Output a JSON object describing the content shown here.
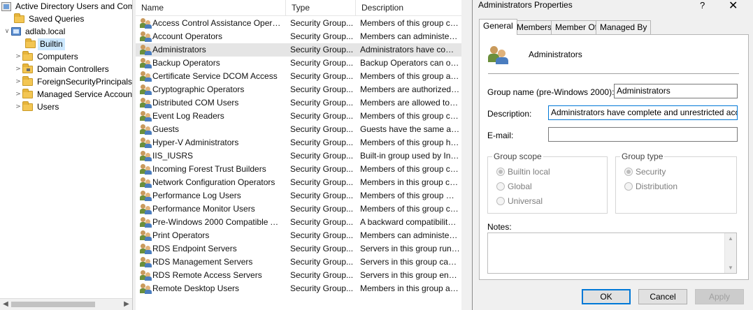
{
  "tree": {
    "root": "Active Directory Users and Computers",
    "items": [
      {
        "label": "Saved Queries",
        "icon": "folder-icon",
        "expander": ""
      },
      {
        "label": "adlab.local",
        "icon": "domain-icon",
        "expander": "∨"
      },
      {
        "label": "Builtin",
        "icon": "folder-icon",
        "expander": "",
        "selected": true
      },
      {
        "label": "Computers",
        "icon": "folder-icon",
        "expander": ">"
      },
      {
        "label": "Domain Controllers",
        "icon": "ou-folder-icon",
        "expander": ">"
      },
      {
        "label": "ForeignSecurityPrincipals",
        "icon": "folder-icon",
        "expander": ">"
      },
      {
        "label": "Managed Service Accounts",
        "icon": "folder-icon",
        "expander": ">"
      },
      {
        "label": "Users",
        "icon": "folder-icon",
        "expander": ">"
      }
    ]
  },
  "list": {
    "columns": {
      "name": "Name",
      "type": "Type",
      "description": "Description"
    },
    "rows": [
      {
        "name": "Access Control Assistance Operators",
        "type": "Security Group...",
        "description": "Members of this group can remotely query authorization attributes"
      },
      {
        "name": "Account Operators",
        "type": "Security Group...",
        "description": "Members can administer domain user and group accounts"
      },
      {
        "name": "Administrators",
        "type": "Security Group...",
        "description": "Administrators have complete and unrestricted access",
        "selected": true
      },
      {
        "name": "Backup Operators",
        "type": "Security Group...",
        "description": "Backup Operators can override security restrictions"
      },
      {
        "name": "Certificate Service DCOM Access",
        "type": "Security Group...",
        "description": "Members of this group are allowed to connect"
      },
      {
        "name": "Cryptographic Operators",
        "type": "Security Group...",
        "description": "Members are authorized to perform cryptographic operations"
      },
      {
        "name": "Distributed COM Users",
        "type": "Security Group...",
        "description": "Members are allowed to launch, activate and use"
      },
      {
        "name": "Event Log Readers",
        "type": "Security Group...",
        "description": "Members of this group can read event logs"
      },
      {
        "name": "Guests",
        "type": "Security Group...",
        "description": "Guests have the same access as members of the Users group"
      },
      {
        "name": "Hyper-V Administrators",
        "type": "Security Group...",
        "description": "Members of this group have complete access"
      },
      {
        "name": "IIS_IUSRS",
        "type": "Security Group...",
        "description": "Built-in group used by Internet Information Services"
      },
      {
        "name": "Incoming Forest Trust Builders",
        "type": "Security Group...",
        "description": "Members of this group can create incoming"
      },
      {
        "name": "Network Configuration Operators",
        "type": "Security Group...",
        "description": "Members in this group can have some privileges"
      },
      {
        "name": "Performance Log Users",
        "type": "Security Group...",
        "description": "Members of this group may schedule logging"
      },
      {
        "name": "Performance Monitor Users",
        "type": "Security Group...",
        "description": "Members of this group can access performance counter data"
      },
      {
        "name": "Pre-Windows 2000 Compatible Access",
        "type": "Security Group...",
        "description": "A backward compatibility group which allows read access"
      },
      {
        "name": "Print Operators",
        "type": "Security Group...",
        "description": "Members can administer printers installed on domain controllers"
      },
      {
        "name": "RDS Endpoint Servers",
        "type": "Security Group...",
        "description": "Servers in this group run virtual machines"
      },
      {
        "name": "RDS Management Servers",
        "type": "Security Group...",
        "description": "Servers in this group can perform routine administrative actions"
      },
      {
        "name": "RDS Remote Access Servers",
        "type": "Security Group...",
        "description": "Servers in this group enable users of RemoteApp programs"
      },
      {
        "name": "Remote Desktop Users",
        "type": "Security Group...",
        "description": "Members in this group are granted the right to logon remotely"
      }
    ]
  },
  "dialog": {
    "title": "Administrators Properties",
    "help": "?",
    "close": "✕",
    "tabs": [
      "General",
      "Members",
      "Member Of",
      "Managed By"
    ],
    "group_display_name": "Administrators",
    "fields": {
      "group_name_label": "Group name (pre-Windows 2000):",
      "group_name_value": "Administrators",
      "description_label": "Description:",
      "description_value": "Administrators have complete and unrestricted access to the computer/domain",
      "email_label": "E-mail:",
      "email_value": ""
    },
    "group_scope": {
      "title": "Group scope",
      "options": [
        "Builtin local",
        "Global",
        "Universal"
      ],
      "selected": 0
    },
    "group_type": {
      "title": "Group type",
      "options": [
        "Security",
        "Distribution"
      ],
      "selected": 0
    },
    "notes_label": "Notes:",
    "buttons": {
      "ok": "OK",
      "cancel": "Cancel",
      "apply": "Apply"
    }
  },
  "colors": {
    "selection": "#cce8ff",
    "row_selected": "#e5e5e5",
    "accent": "#0078d7"
  }
}
